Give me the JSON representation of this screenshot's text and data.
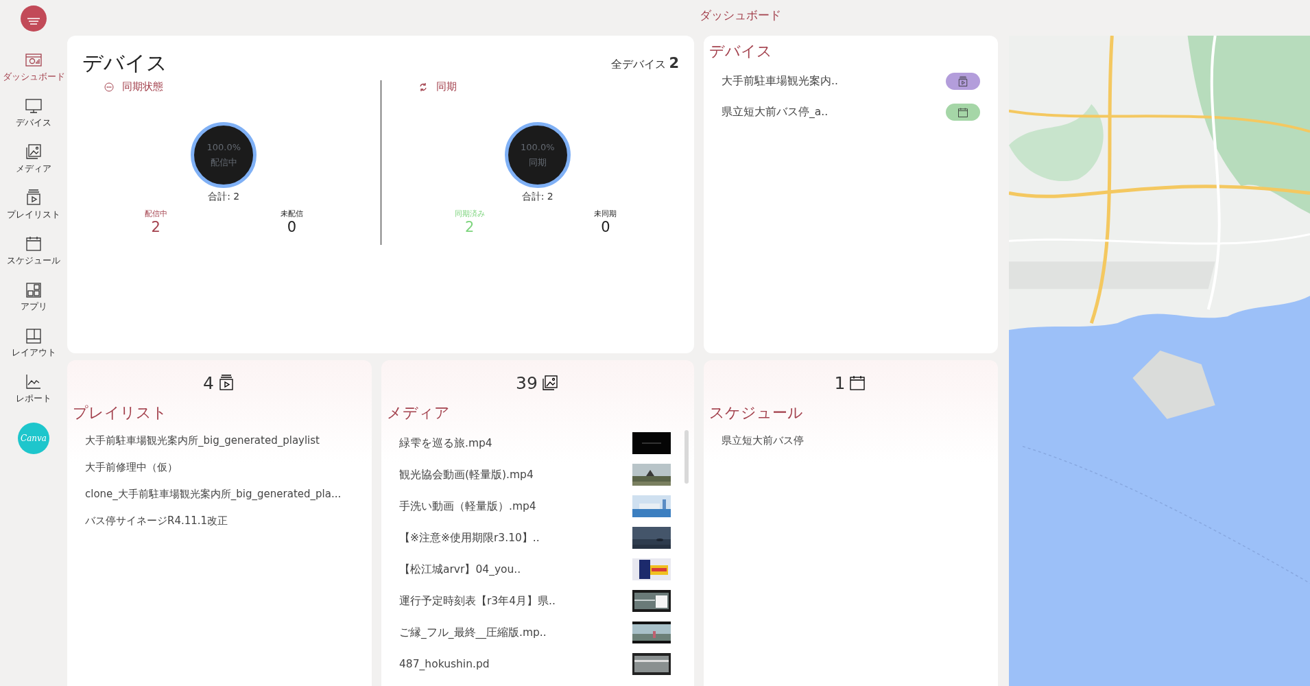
{
  "header": {
    "title": "ダッシュボード"
  },
  "sidebar": {
    "items": [
      {
        "label": "ダッシュボード",
        "selected": true
      },
      {
        "label": "デバイス",
        "selected": false
      },
      {
        "label": "メディア",
        "selected": false
      },
      {
        "label": "プレイリスト",
        "selected": false
      },
      {
        "label": "スケジュール",
        "selected": false
      },
      {
        "label": "アプリ",
        "selected": false
      },
      {
        "label": "レイアウト",
        "selected": false
      },
      {
        "label": "レポート",
        "selected": false
      }
    ],
    "canva": "Canva"
  },
  "device_summary": {
    "title": "デバイス",
    "total_label": "全デバイス",
    "total": "2",
    "panels": [
      {
        "title": "同期状態",
        "percent": "100.0%",
        "center_label": "配信中",
        "sum": "合計: 2",
        "stats": [
          {
            "label": "配信中",
            "value": "2",
            "color": "#a3414d"
          },
          {
            "label": "未配信",
            "value": "0",
            "color": "#222222"
          }
        ]
      },
      {
        "title": "同期",
        "percent": "100.0%",
        "center_label": "同期",
        "sum": "合計: 2",
        "stats": [
          {
            "label": "同期済み",
            "value": "2",
            "color": "#7dd47d"
          },
          {
            "label": "未同期",
            "value": "0",
            "color": "#222222"
          }
        ]
      }
    ]
  },
  "device_list": {
    "title": "デバイス",
    "items": [
      {
        "name": "大手前駐車場観光案内..",
        "kind": "playlist",
        "color": "#b39ddb"
      },
      {
        "name": "県立短大前バス停_a..",
        "kind": "schedule",
        "color": "#a5d6a7"
      }
    ]
  },
  "playlists": {
    "count": "4",
    "title": "プレイリスト",
    "items": [
      "大手前駐車場観光案内所_big_generated_playlist",
      "大手前修理中（仮）",
      "clone_大手前駐車場観光案内所_big_generated_pla...",
      "バス停サイネージR4.11.1改正"
    ]
  },
  "media": {
    "count": "39",
    "title": "メディア",
    "items": [
      "緑雫を巡る旅.mp4",
      "観光協会動画(軽量版).mp4",
      "手洗い動画（軽量版）.mp4",
      "【※注意※使用期限r3.10】..",
      "【松江城arvr】04_you..",
      "運行予定時刻表【r3年4月】県..",
      "ご縁_フル_最終__圧縮版.mp..",
      "487_hokushin.pd"
    ]
  },
  "schedules": {
    "count": "1",
    "title": "スケジュール",
    "items": [
      "県立短大前バス停"
    ]
  }
}
